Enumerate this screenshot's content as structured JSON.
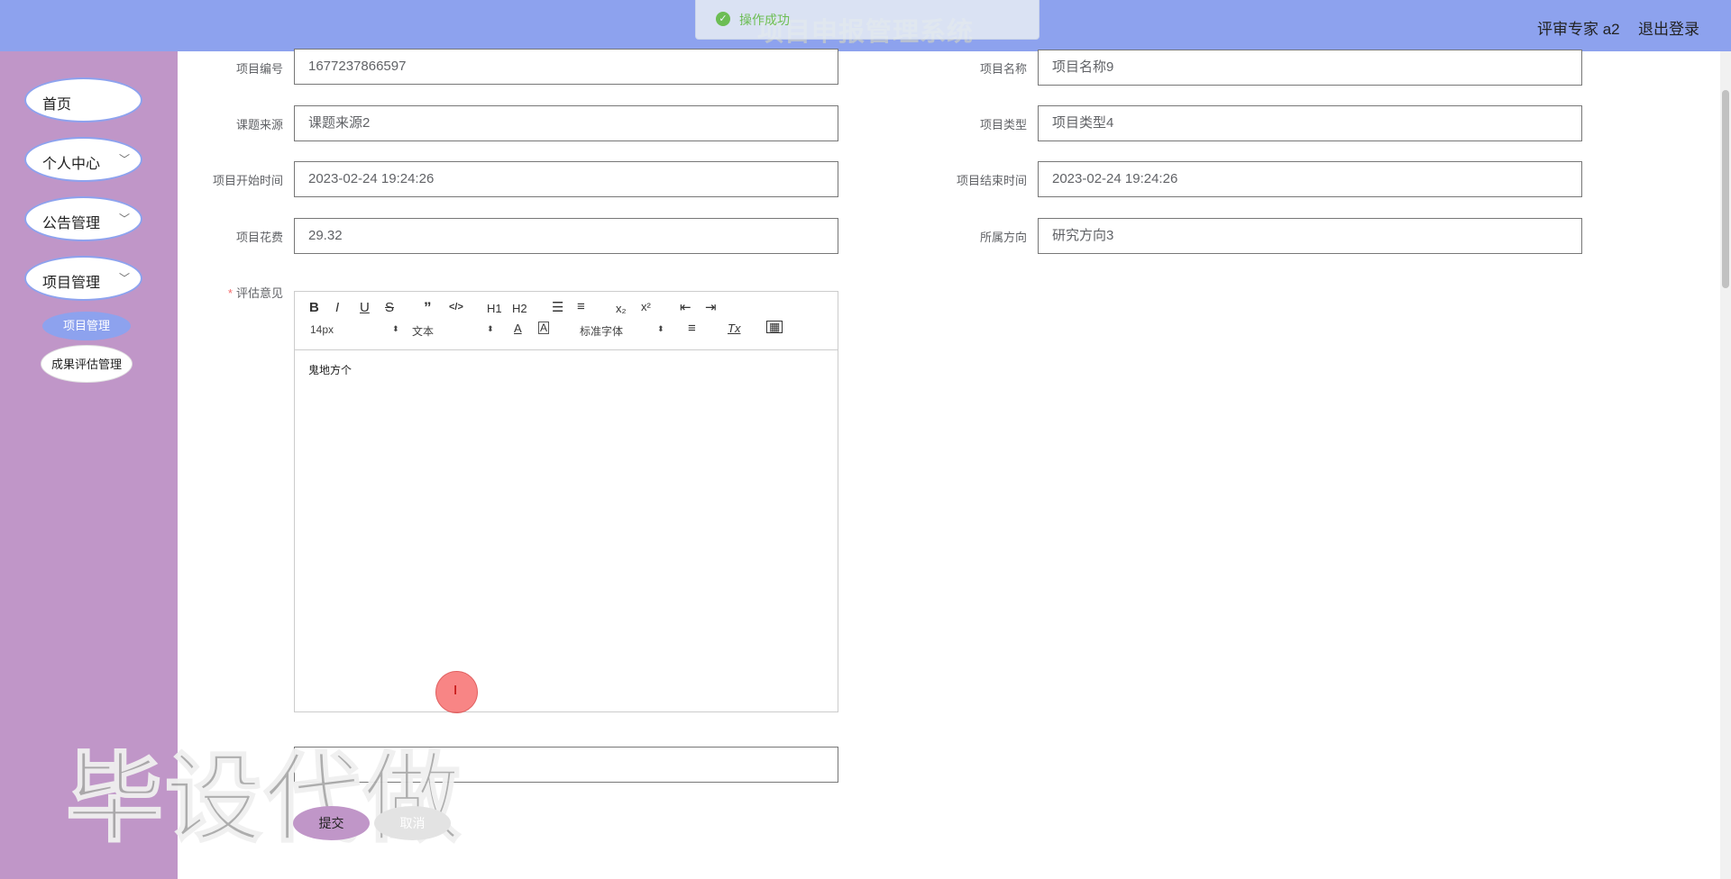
{
  "header": {
    "title": "项目申报管理系统",
    "toast": "操作成功",
    "user": "评审专家 a2",
    "logout": "退出登录"
  },
  "sidebar": {
    "items": [
      {
        "label": "首页"
      },
      {
        "label": "个人中心"
      },
      {
        "label": "公告管理"
      },
      {
        "label": "项目管理"
      }
    ],
    "subitems": [
      {
        "label": "项目管理"
      },
      {
        "label": "成果评估管理"
      }
    ]
  },
  "form": {
    "project_no_label": "项目编号",
    "project_no": "1677237866597",
    "project_name_label": "项目名称",
    "project_name": "项目名称9",
    "source_label": "课题来源",
    "source": "课题来源2",
    "type_label": "项目类型",
    "type": "项目类型4",
    "start_label": "项目开始时间",
    "start": "2023-02-24 19:24:26",
    "end_label": "项目结束时间",
    "end": "2023-02-24 19:24:26",
    "cost_label": "项目花费",
    "cost": "29.32",
    "direction_label": "所属方向",
    "direction": "研究方向3",
    "opinion_label": "评估意见"
  },
  "editor": {
    "h1": "H1",
    "h2": "H2",
    "size": "14px",
    "format": "文本",
    "font": "标准字体",
    "content": "鬼地方个"
  },
  "buttons": {
    "submit": "提交",
    "cancel": "取消"
  },
  "watermark": "毕设代做"
}
